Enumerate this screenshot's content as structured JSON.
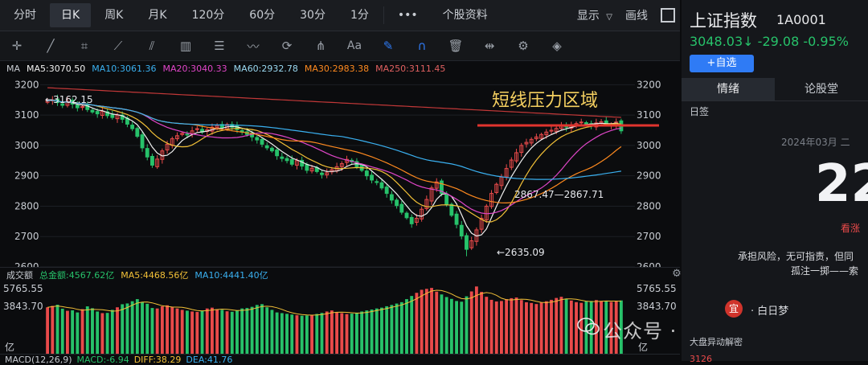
{
  "toolbar": {
    "tabs": [
      "分时",
      "日K",
      "周K",
      "月K",
      "120分",
      "60分",
      "30分",
      "1分"
    ],
    "active_tab": "日K",
    "more": "•••",
    "profile": "个股资料",
    "display": "显示",
    "draw": "画线"
  },
  "indicator_bar": {
    "label": "MA",
    "ma5": "MA5:3070.50",
    "ma10": "MA10:3061.36",
    "ma20": "MA20:3040.33",
    "ma60": "MA60:2932.78",
    "ma30": "MA30:2983.38",
    "ma250": "MA250:3111.45"
  },
  "colors": {
    "up": "#e94a4a",
    "down": "#27c26a",
    "ma5": "#f0f0f0",
    "ma10": "#f2c037",
    "ma20": "#e046c8",
    "ma30": "#ff8a1f",
    "ma60": "#3ab0f0",
    "ma250": "#c23838",
    "accent": "#2f7bf5"
  },
  "price_axis": {
    "left": [
      "3200",
      "3100",
      "3000",
      "2900",
      "2800",
      "2700",
      "2600"
    ],
    "right": [
      "3200",
      "3100",
      "3000",
      "2900",
      "2800",
      "2700",
      "2600"
    ]
  },
  "annotations": {
    "resistance": "短线压力区域",
    "high": "←3162.15",
    "gap": "2867.47—2867.71",
    "low": "←2635.09"
  },
  "volume_bar": {
    "label": "成交额",
    "total": "总金额:4567.62亿",
    "ma5": "MA5:4468.56亿",
    "ma10": "MA10:4441.40亿",
    "axis_top": "5765.55",
    "axis_mid": "3843.70",
    "axis_unit": "亿"
  },
  "macd_bar": {
    "label": "MACD(12,26,9)",
    "macd": "MACD:-6.94",
    "diff": "DIFF:38.29",
    "dea": "DEA:41.76"
  },
  "panel": {
    "name": "上证指数",
    "code": "1A0001",
    "price": "3048.03",
    "change": "-29.08",
    "pct": "-0.95%",
    "add_watch": "+自选",
    "tabs": [
      "情绪",
      "论股堂"
    ],
    "sub_tab": "日签",
    "date": "2024年03月 二",
    "day": "22",
    "mood": "看涨",
    "quote_line1": "承担风险，无可指责，但同",
    "quote_line2": "孤注一掷——索",
    "yi_badge": "宜",
    "author": "· 白日梦",
    "news_title": "大盘异动解密",
    "news_value": "3126"
  },
  "watermark": "公众号 · 老巴看盘",
  "chart_data": {
    "type": "candlestick",
    "price_ylim": [
      2600,
      3230
    ],
    "key_levels": {
      "high": 3162.15,
      "low": 2635.09,
      "gap_low": 2867.47,
      "gap_high": 2867.71,
      "resistance": 3075
    },
    "close": [
      3148,
      3150,
      3141,
      3132,
      3145,
      3136,
      3124,
      3128,
      3118,
      3110,
      3104,
      3112,
      3098,
      3092,
      3100,
      3086,
      3070,
      3055,
      3030,
      2992,
      2962,
      2935,
      2955,
      2982,
      3004,
      3022,
      3032,
      3040,
      3036,
      3048,
      3055,
      3044,
      3052,
      3060,
      3066,
      3058,
      3069,
      3060,
      3052,
      3044,
      3036,
      3028,
      3018,
      3004,
      2992,
      2982,
      2966,
      2957,
      2950,
      2938,
      2950,
      2932,
      2918,
      2925,
      2914,
      2904,
      2910,
      2920,
      2930,
      2940,
      2954,
      2946,
      2930,
      2918,
      2900,
      2886,
      2878,
      2860,
      2842,
      2820,
      2802,
      2780,
      2762,
      2742,
      2760,
      2790,
      2822,
      2860,
      2880,
      2842,
      2806,
      2770,
      2740,
      2702,
      2658,
      2686,
      2722,
      2760,
      2800,
      2842,
      2872,
      2896,
      2924,
      2952,
      2976,
      3000,
      3010,
      3020,
      3028,
      3036,
      3044,
      3050,
      3056,
      3064,
      3060,
      3066,
      3072,
      3077,
      3070,
      3066,
      3074,
      3078,
      3071,
      3068,
      3077,
      3048
    ],
    "volume_ylim": [
      0,
      6200
    ],
    "volume": [
      3980,
      4100,
      4200,
      3860,
      3680,
      3720,
      3540,
      3820,
      4060,
      3900,
      3620,
      3480,
      3500,
      3760,
      3980,
      4240,
      4310,
      4500,
      4680,
      4420,
      4280,
      3920,
      3880,
      4060,
      4150,
      4010,
      3880,
      3760,
      3690,
      3620,
      3580,
      3700,
      3880,
      3950,
      3820,
      3760,
      3640,
      3600,
      3710,
      3880,
      3920,
      4020,
      4180,
      4250,
      3980,
      3760,
      3540,
      3480,
      3420,
      3360,
      3300,
      3260,
      3280,
      3340,
      3410,
      3500,
      3620,
      3710,
      3540,
      3480,
      3400,
      3440,
      3520,
      3620,
      3710,
      3790,
      3880,
      3950,
      4070,
      4180,
      4300,
      4420,
      4680,
      4950,
      5220,
      5480,
      5560,
      5640,
      5320,
      5080,
      4860,
      4700,
      4520,
      4460,
      4920,
      5340,
      5765,
      5300,
      4880,
      4620,
      4480,
      4520,
      4680,
      4760,
      4820,
      4600,
      4410,
      4350,
      4260,
      4380,
      4500,
      4620,
      4780,
      4880,
      4700,
      4560,
      4420,
      4360,
      4480,
      4520,
      4600,
      4520,
      4490,
      4440,
      4500,
      4567
    ]
  }
}
